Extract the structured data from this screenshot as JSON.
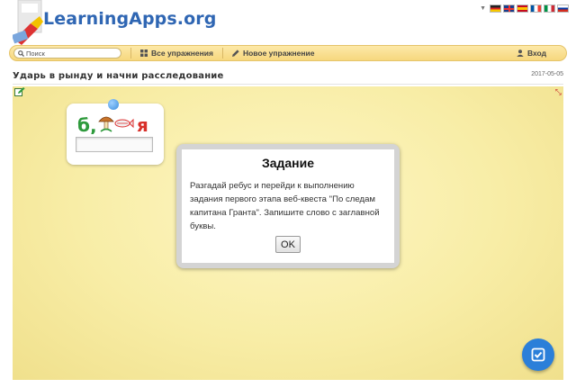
{
  "header": {
    "logo_text": "LearningApps.org",
    "languages": [
      "de",
      "en",
      "es",
      "fr",
      "it",
      "ru"
    ]
  },
  "nav": {
    "search_placeholder": "Поиск",
    "all_exercises": "Все упражнения",
    "new_exercise": "Новое упражнение",
    "login": "Вход"
  },
  "page": {
    "title": "Ударь в рынду и начни расследование",
    "date": "2017-05-05"
  },
  "rebus": {
    "letter_start": "б",
    "comma": ",",
    "letter_end": "я",
    "answer_value": ""
  },
  "dialog": {
    "title": "Задание",
    "text": "Разгадай ребус и перейди к выполнению задания первого этапа веб-квеста \"По следам капитана Гранта\". Запишите слово с заглавной буквы.",
    "ok_label": "OK"
  },
  "colors": {
    "accent_blue": "#2b7fd9",
    "logo_blue": "#2f66b3",
    "nav_yellow": "#f6d77e",
    "stage_yellow": "#f8eda6",
    "rebus_green": "#2e9a3c",
    "rebus_red": "#d8302a"
  },
  "icons": {
    "search": "search-icon",
    "grid": "grid-icon",
    "pencil": "pencil-icon",
    "user": "user-icon",
    "check": "check-icon",
    "fullscreen": "fullscreen-icon",
    "edit": "edit-icon"
  }
}
